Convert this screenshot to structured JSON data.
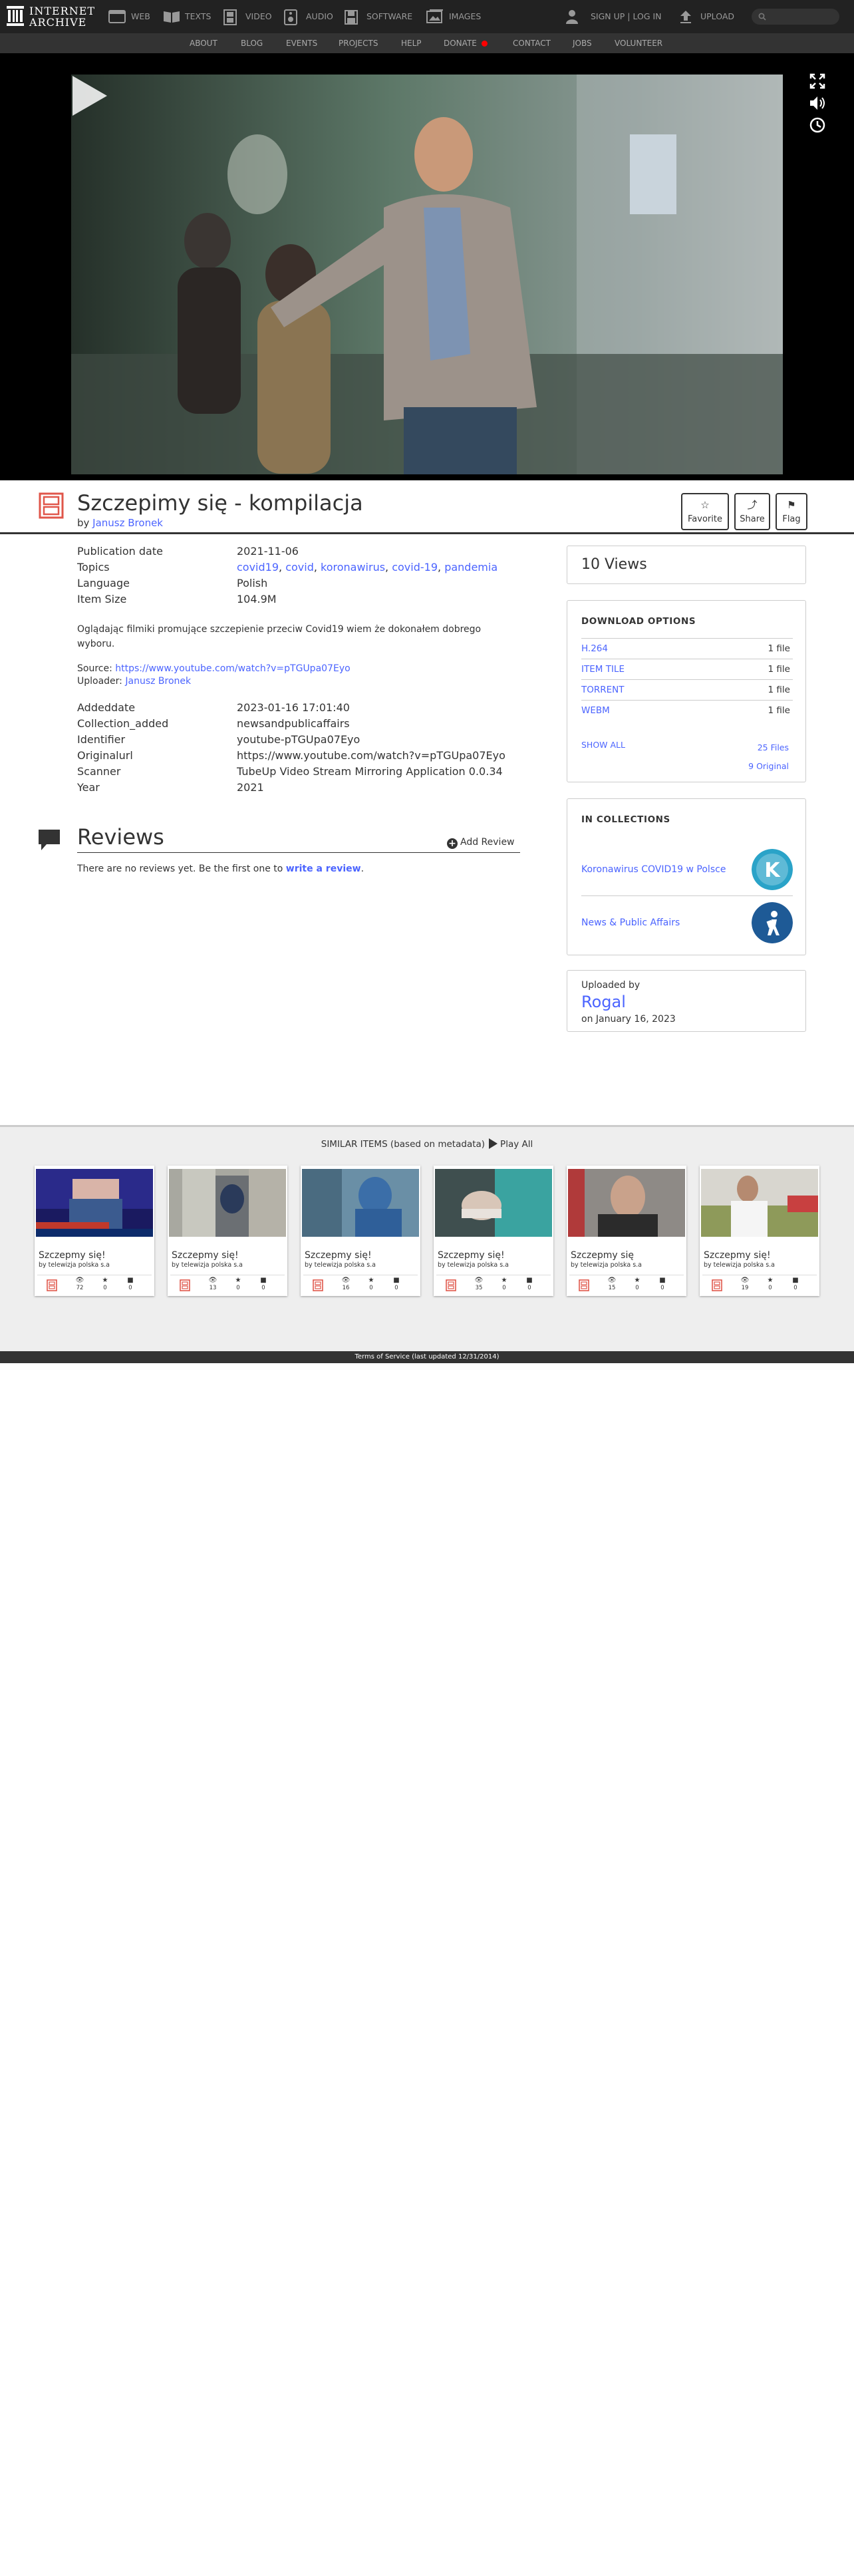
{
  "nav": {
    "logo_line1": "INTERNET",
    "logo_line2": "ARCHIVE",
    "media": [
      "WEB",
      "TEXTS",
      "VIDEO",
      "AUDIO",
      "SOFTWARE",
      "IMAGES"
    ],
    "signup": "SIGN UP | LOG IN",
    "upload": "UPLOAD"
  },
  "subnav": [
    "ABOUT",
    "BLOG",
    "EVENTS",
    "PROJECTS",
    "HELP",
    "DONATE",
    "CONTACT",
    "JOBS",
    "VOLUNTEER"
  ],
  "item": {
    "title": "Szczepimy się - kompilacja",
    "by_prefix": "by ",
    "author": "Janusz Bronek",
    "buttons": {
      "favorite": "Favorite",
      "share": "Share",
      "flag": "Flag"
    }
  },
  "metadata": {
    "publication_date_label": "Publication date",
    "publication_date": "2021-11-06",
    "topics_label": "Topics",
    "topics": [
      "covid19",
      "covid",
      "koronawirus",
      "covid-19",
      "pandemia"
    ],
    "language_label": "Language",
    "language": "Polish",
    "item_size_label": "Item Size",
    "item_size": "104.9M",
    "description": "Oglądając filmiki promujące szczepienie przeciw Covid19 wiem że dokonałem dobrego wyboru.",
    "source_label": "Source:",
    "source_url": "https://www.youtube.com/watch?v=pTGUpa07Eyo",
    "uploader_label": "Uploader:",
    "uploader": "Janusz Bronek",
    "addeddate_label": "Addeddate",
    "addeddate": "2023-01-16 17:01:40",
    "collection_added_label": "Collection_added",
    "collection_added": "newsandpublicaffairs",
    "identifier_label": "Identifier",
    "identifier": "youtube-pTGUpa07Eyo",
    "originalurl_label": "Originalurl",
    "originalurl": "https://www.youtube.com/watch?v=pTGUpa07Eyo",
    "scanner_label": "Scanner",
    "scanner": "TubeUp Video Stream Mirroring Application 0.0.34",
    "year_label": "Year",
    "year": "2021"
  },
  "reviews": {
    "title": "Reviews",
    "add": "Add Review",
    "empty_prefix": "There are no reviews yet. Be the first one to ",
    "empty_link": "write a review",
    "empty_suffix": "."
  },
  "views": "10 Views",
  "download": {
    "title": "DOWNLOAD OPTIONS",
    "rows": [
      {
        "format": "H.264",
        "count": "1 file"
      },
      {
        "format": "ITEM TILE",
        "count": "1 file"
      },
      {
        "format": "TORRENT",
        "count": "1 file"
      },
      {
        "format": "WEBM",
        "count": "1 file"
      }
    ],
    "show_all": "SHOW ALL",
    "all_files": "25 Files",
    "original_files": "9 Original"
  },
  "collections": {
    "title": "IN COLLECTIONS",
    "items": [
      {
        "name": "Koronawirus COVID19 w Polsce",
        "color": "#2aa3c8",
        "letter": "K"
      },
      {
        "name": "News & Public Affairs",
        "color": "#1e5a96",
        "letter": ""
      }
    ]
  },
  "uploader_box": {
    "label": "Uploaded by",
    "name": "Rogal",
    "date": "on January 16, 2023"
  },
  "similar": {
    "title": "SIMILAR ITEMS (based on metadata)",
    "play_all": "Play All",
    "tiles": [
      {
        "title": "Szczepmy się!",
        "by": "by telewizja polska s.a",
        "views": "72",
        "favs": "0",
        "reviews": "0"
      },
      {
        "title": "Szczepmy się!",
        "by": "by telewizja polska s.a",
        "views": "13",
        "favs": "0",
        "reviews": "0"
      },
      {
        "title": "Szczepmy się!",
        "by": "by telewizja polska s.a",
        "views": "16",
        "favs": "0",
        "reviews": "0"
      },
      {
        "title": "Szczepmy się!",
        "by": "by telewizja polska s.a",
        "views": "35",
        "favs": "0",
        "reviews": "0"
      },
      {
        "title": "Szczepmy się",
        "by": "by telewizja polska s.a",
        "views": "15",
        "favs": "0",
        "reviews": "0"
      },
      {
        "title": "Szczepmy się!",
        "by": "by telewizja polska s.a",
        "views": "19",
        "favs": "0",
        "reviews": "0"
      }
    ]
  },
  "footer": "Terms of Service (last updated 12/31/2014)"
}
